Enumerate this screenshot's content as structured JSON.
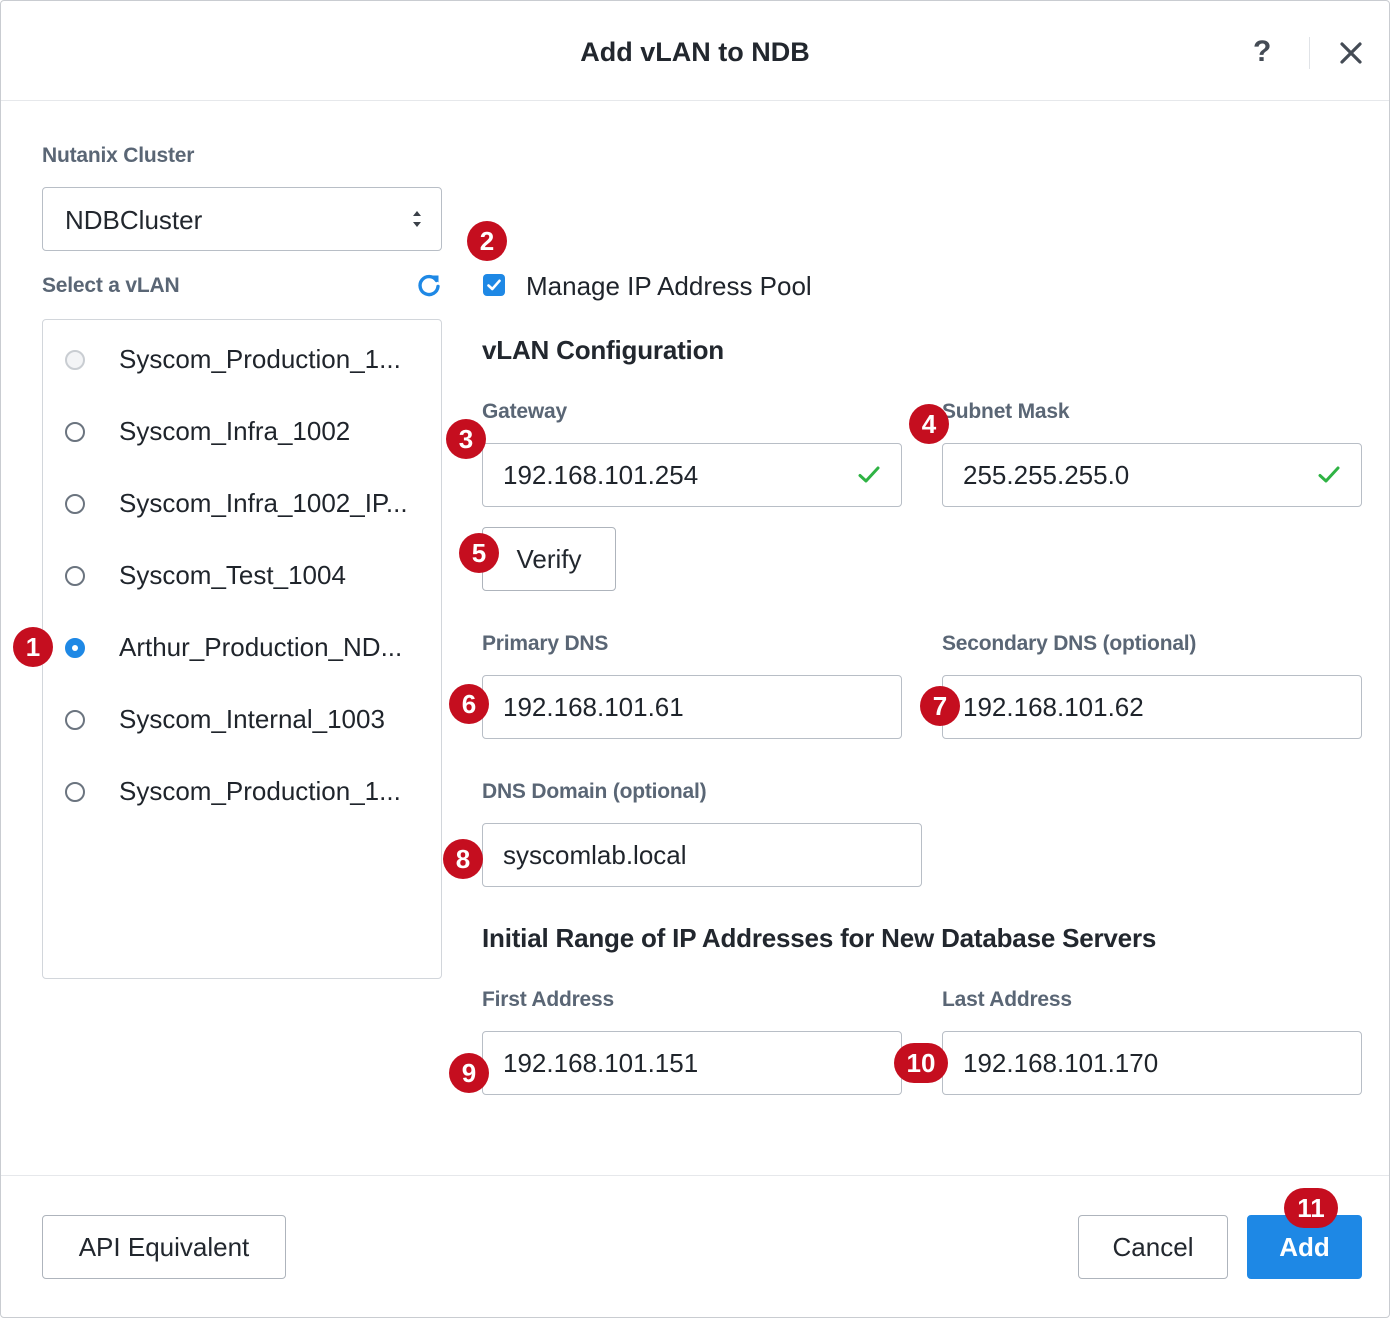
{
  "dialog": {
    "title": "Add vLAN to NDB",
    "help_symbol": "?"
  },
  "cluster": {
    "label": "Nutanix Cluster",
    "selected": "NDBCluster"
  },
  "vlan_select": {
    "label": "Select a vLAN",
    "items": [
      {
        "label": "Syscom_Production_1...",
        "state": "disabled"
      },
      {
        "label": "Syscom_Infra_1002",
        "state": "unchecked"
      },
      {
        "label": "Syscom_Infra_1002_IP...",
        "state": "unchecked"
      },
      {
        "label": "Syscom_Test_1004",
        "state": "unchecked"
      },
      {
        "label": "Arthur_Production_ND...",
        "state": "checked"
      },
      {
        "label": "Syscom_Internal_1003",
        "state": "unchecked"
      },
      {
        "label": "Syscom_Production_1...",
        "state": "unchecked"
      }
    ]
  },
  "manage_pool": {
    "label": "Manage IP Address Pool",
    "checked": true
  },
  "vlan_config": {
    "title": "vLAN Configuration",
    "gateway_label": "Gateway",
    "gateway_value": "192.168.101.254",
    "subnet_label": "Subnet Mask",
    "subnet_value": "255.255.255.0",
    "verify_label": "Verify",
    "primary_dns_label": "Primary DNS",
    "primary_dns_value": "192.168.101.61",
    "secondary_dns_label": "Secondary DNS (optional)",
    "secondary_dns_value": "192.168.101.62",
    "dns_domain_label": "DNS Domain (optional)",
    "dns_domain_value": "syscomlab.local"
  },
  "ip_range": {
    "title": "Initial Range of IP Addresses for New Database Servers",
    "first_label": "First Address",
    "first_value": "192.168.101.151",
    "last_label": "Last Address",
    "last_value": "192.168.101.170"
  },
  "footer": {
    "api_label": "API Equivalent",
    "cancel_label": "Cancel",
    "add_label": "Add"
  },
  "annotations": [
    "1",
    "2",
    "3",
    "4",
    "5",
    "6",
    "7",
    "8",
    "9",
    "10",
    "11"
  ],
  "colors": {
    "accent": "#1e88e5",
    "badge": "#c50e1f",
    "valid": "#2fb344"
  }
}
